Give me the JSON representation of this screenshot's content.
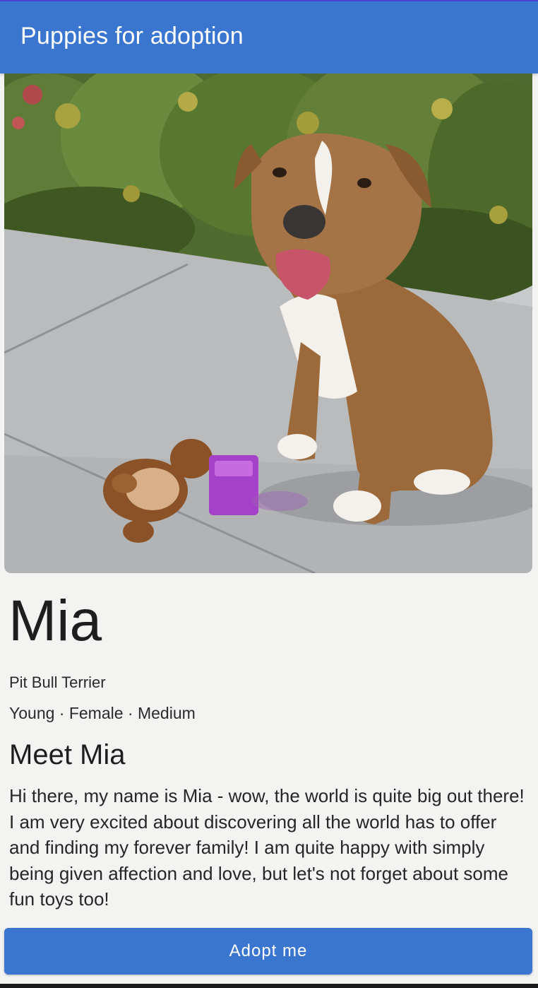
{
  "app_bar": {
    "title": "Puppies for adoption"
  },
  "pet": {
    "photo_icon": "dog-photo",
    "name": "Mia",
    "breed": "Pit Bull Terrier",
    "attributes": "Young · Female · Medium",
    "section_title": "Meet Mia",
    "description": "Hi there, my name is Mia - wow, the world is quite big out there! I am very excited about discovering all the world has to offer and finding my forever family! I am quite happy with simply being given affection and love, but let's not forget about some fun toys too!"
  },
  "actions": {
    "adopt_label": "Adopt me"
  },
  "colors": {
    "primary": "#3a76cf",
    "background": "#f3f3f2",
    "text": "#1e1e1e"
  }
}
